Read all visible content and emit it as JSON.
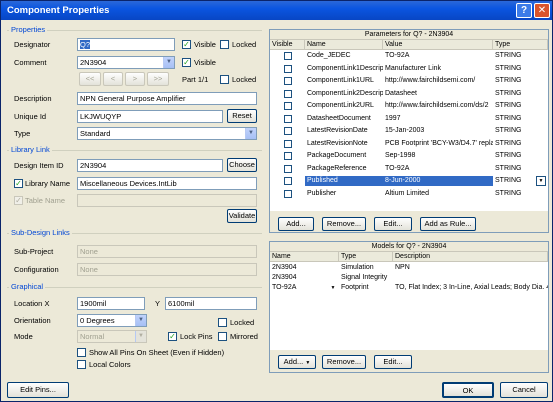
{
  "window": {
    "title": "Component Properties",
    "help_glyph": "?",
    "close_glyph": "✕"
  },
  "properties": {
    "group_title": "Properties",
    "designator_label": "Designator",
    "designator_value": "Q?",
    "comment_label": "Comment",
    "comment_value": "2N3904",
    "visible_label": "Visible",
    "locked_label": "Locked",
    "nav_first": "<<",
    "nav_prev": "<",
    "nav_next": ">",
    "nav_last": ">>",
    "part_text": "Part 1/1",
    "description_label": "Description",
    "description_value": "NPN General Purpose Amplifier",
    "unique_id_label": "Unique Id",
    "unique_id_value": "LKJWUQYP",
    "reset_label": "Reset",
    "type_label": "Type",
    "type_value": "Standard"
  },
  "library_link": {
    "group_title": "Library Link",
    "design_item_label": "Design Item ID",
    "design_item_value": "2N3904",
    "choose_label": "Choose",
    "library_name_label": "Library Name",
    "library_name_value": "Miscellaneous Devices.IntLib",
    "table_name_label": "Table Name",
    "table_name_value": "",
    "validate_label": "Validate"
  },
  "sub_design": {
    "group_title": "Sub-Design Links",
    "sub_project_label": "Sub-Project",
    "sub_project_value": "None",
    "configuration_label": "Configuration",
    "configuration_value": "None"
  },
  "graphical": {
    "group_title": "Graphical",
    "location_label": "Location X",
    "location_x": "1900mil",
    "y_label": "Y",
    "location_y": "6100mil",
    "orientation_label": "Orientation",
    "orientation_value": "0 Degrees",
    "locked_label": "Locked",
    "mode_label": "Mode",
    "mode_value": "Normal",
    "lock_pins_label": "Lock Pins",
    "mirrored_label": "Mirrored",
    "show_all_pins_label": "Show All Pins On Sheet (Even if Hidden)",
    "local_colors_label": "Local Colors"
  },
  "parameters": {
    "header": "Parameters for Q? - 2N3904",
    "columns": [
      "Visible",
      "Name",
      "Value",
      "Type"
    ],
    "rows": [
      {
        "name": "Code_JEDEC",
        "value": "TO-92A",
        "type": "STRING"
      },
      {
        "name": "ComponentLink1Description",
        "value": "Manufacturer Link",
        "type": "STRING"
      },
      {
        "name": "ComponentLink1URL",
        "value": "http://www.fairchildsemi.com/",
        "type": "STRING"
      },
      {
        "name": "ComponentLink2Description",
        "value": "Datasheet",
        "type": "STRING"
      },
      {
        "name": "ComponentLink2URL",
        "value": "http://www.fairchildsemi.com/ds/2",
        "type": "STRING"
      },
      {
        "name": "DatasheetDocument",
        "value": "1997",
        "type": "STRING"
      },
      {
        "name": "LatestRevisionDate",
        "value": "15-Jan-2003",
        "type": "STRING"
      },
      {
        "name": "LatestRevisionNote",
        "value": "PCB Footprint 'BCY-W3/D4.7' replac",
        "type": "STRING"
      },
      {
        "name": "PackageDocument",
        "value": "Sep-1998",
        "type": "STRING"
      },
      {
        "name": "PackageReference",
        "value": "TO-92A",
        "type": "STRING"
      },
      {
        "name": "Published",
        "value": "8-Jun-2000",
        "type": "STRING"
      },
      {
        "name": "Publisher",
        "value": "Altium Limited",
        "type": "STRING"
      }
    ],
    "add_label": "Add...",
    "remove_label": "Remove...",
    "edit_label": "Edit...",
    "add_rule_label": "Add as Rule..."
  },
  "models": {
    "header": "Models for Q? - 2N3904",
    "columns": [
      "Name",
      "Type",
      "Description"
    ],
    "rows": [
      {
        "name": "2N3904",
        "type": "Simulation",
        "description": "NPN"
      },
      {
        "name": "2N3904",
        "type": "Signal Integrity",
        "description": ""
      },
      {
        "name": "TO-92A",
        "type": "Footprint",
        "description": "TO, Flat Index; 3 In-Line, Axial Leads; Body Dia. 4."
      }
    ],
    "add_label": "Add...",
    "remove_label": "Remove...",
    "edit_label": "Edit..."
  },
  "footer": {
    "edit_pins_label": "Edit Pins...",
    "ok_label": "OK",
    "cancel_label": "Cancel"
  }
}
